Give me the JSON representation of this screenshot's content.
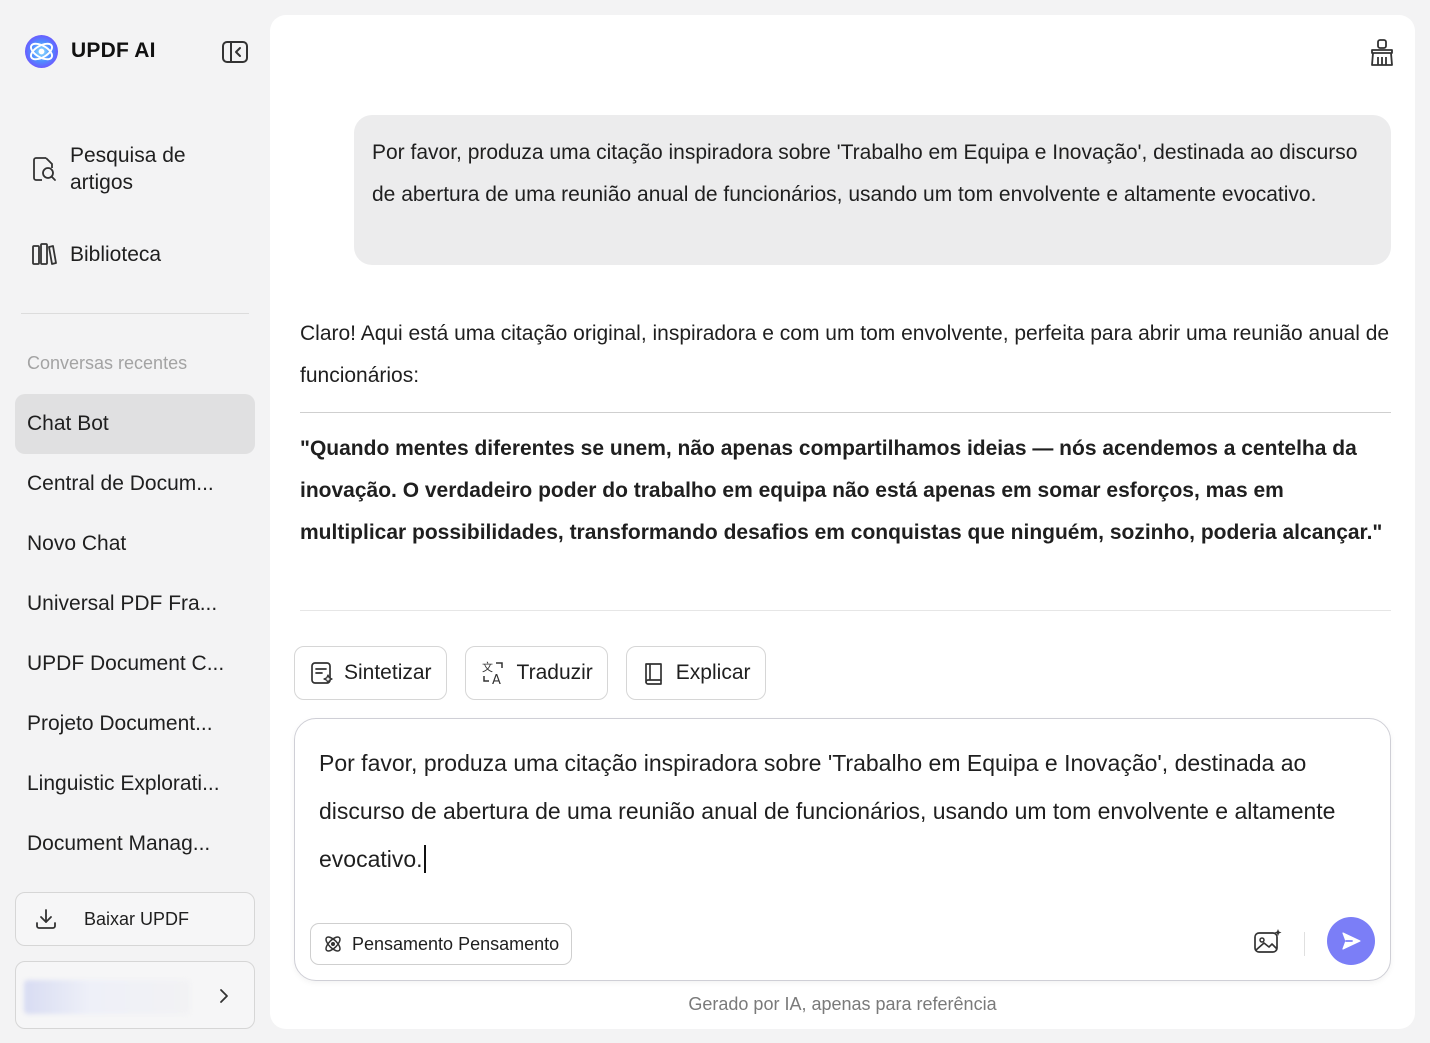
{
  "app": {
    "name": "UPDF AI"
  },
  "sidebar": {
    "nav": [
      {
        "label": "Pesquisa de\nartigos",
        "icon": "document-search-icon"
      },
      {
        "label": "Biblioteca",
        "icon": "library-icon"
      }
    ],
    "recent_header": "Conversas recentes",
    "recent": [
      "Chat Bot",
      "Central de Docum...",
      "Novo Chat",
      "Universal PDF Fra...",
      "UPDF Document C...",
      "Projeto Document...",
      "Linguistic Explorati...",
      "Document Manag..."
    ],
    "active_index": 0,
    "download_label": "Baixar UPDF"
  },
  "chat": {
    "user_message": "Por favor, produza uma citação inspiradora sobre 'Trabalho em Equipa e Inovação', destinada ao discurso de abertura de uma reunião anual de funcionários, usando um tom envolvente e altamente evocativo.",
    "assistant_intro": "Claro! Aqui está uma citação original, inspiradora e com um tom envolvente, perfeita para abrir uma reunião anual de funcionários:",
    "assistant_quote": "\"Quando mentes diferentes se unem, não apenas compartilhamos ideias — nós acendemos a centelha da inovação. O verdadeiro poder do trabalho em equipa não está apenas em somar esforços, mas em multiplicar possibilidades, transformando desafios em conquistas que ninguém, sozinho, poderia alcançar.\""
  },
  "actions": {
    "summarize": "Sintetizar",
    "translate": "Traduzir",
    "explain": "Explicar"
  },
  "composer": {
    "text": "Por favor, produza uma citação inspiradora sobre 'Trabalho em Equipa e Inovação', destinada ao discurso de abertura de uma reunião anual de funcionários, usando um tom envolvente e altamente evocativo.",
    "thinking_label": "Pensamento Pensamento"
  },
  "footer_note": "Gerado por IA, apenas para referência",
  "colors": {
    "accent": "#7b7ef7",
    "bubble": "#ececed",
    "background": "#f3f3f4"
  }
}
